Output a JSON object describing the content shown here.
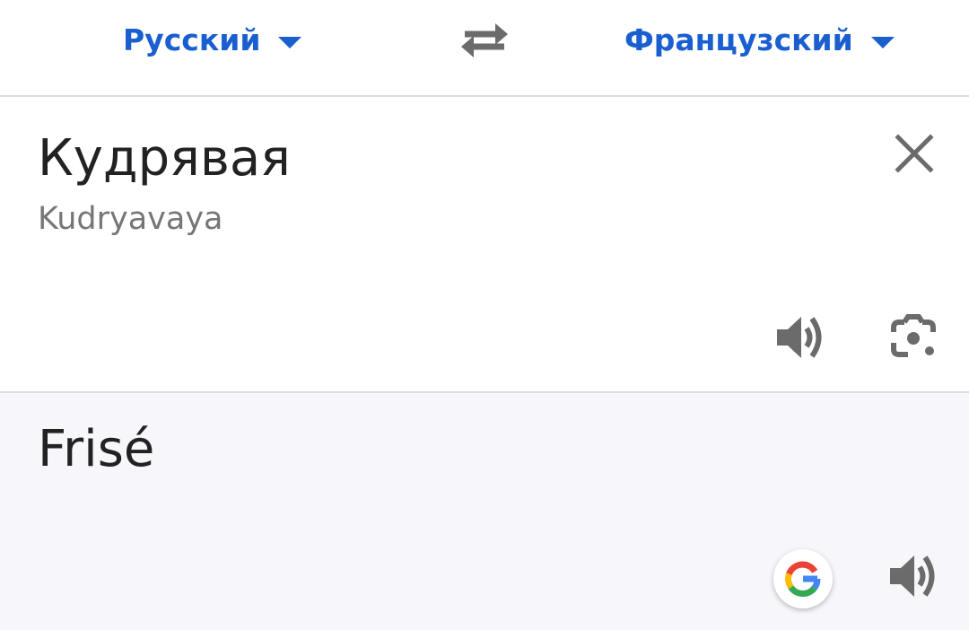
{
  "header": {
    "source_language": "Русский",
    "target_language": "Французский",
    "icons": {
      "swap": "swap-arrows-icon",
      "dropdown": "caret-down-icon"
    }
  },
  "source": {
    "text": "Кудрявая",
    "transliteration": "Kudryavaya",
    "icons": {
      "clear": "close-icon",
      "speak": "speaker-icon",
      "lens": "camera-lens-icon"
    }
  },
  "target": {
    "text": "Frisé",
    "icons": {
      "brand": "google-g-icon",
      "speak": "speaker-icon"
    }
  },
  "colors": {
    "accent": "#1a5fd0",
    "icon_gray": "#6b6b6b",
    "text": "#222222",
    "secondary_text": "#767676",
    "target_background": "#f7f7fb",
    "divider": "#dcdcde"
  }
}
